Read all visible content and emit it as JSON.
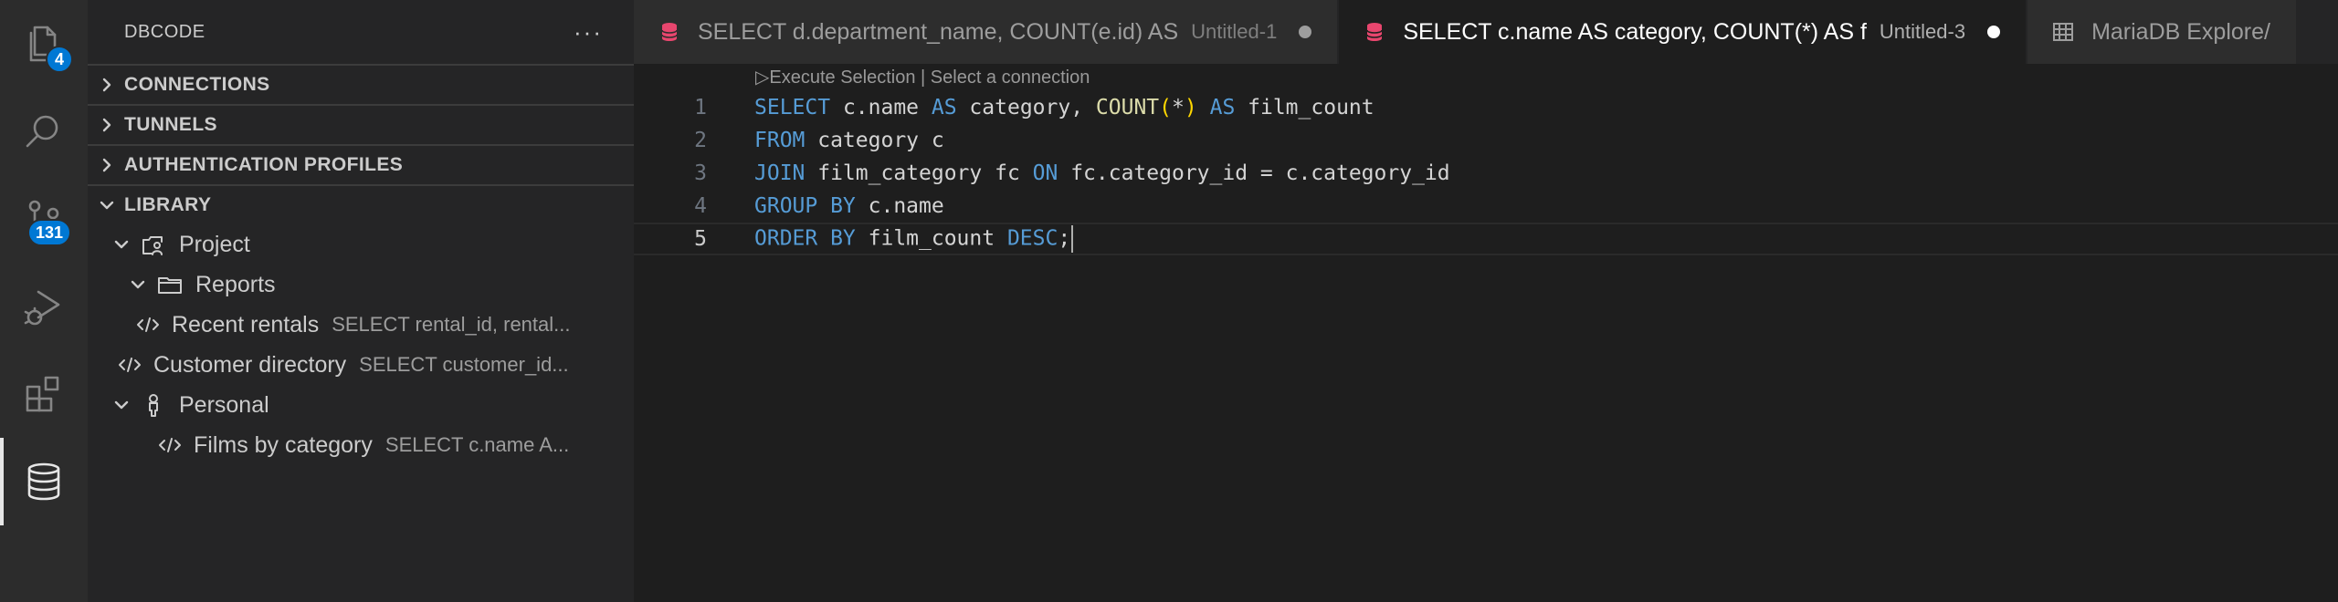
{
  "activity_bar": {
    "explorer_badge": "4",
    "scm_badge": "131",
    "icons": [
      "files-icon",
      "search-icon",
      "source-control-icon",
      "run-debug-icon",
      "extensions-icon",
      "database-icon"
    ]
  },
  "sidebar": {
    "title": "DBCODE",
    "more": "···",
    "sections": {
      "connections": "CONNECTIONS",
      "tunnels": "TUNNELS",
      "auth": "AUTHENTICATION PROFILES",
      "library": "LIBRARY"
    },
    "tree": {
      "project": "Project",
      "reports": "Reports",
      "recent_rentals": {
        "label": "Recent rentals",
        "desc": "SELECT rental_id, rental..."
      },
      "customer_directory": {
        "label": "Customer directory",
        "desc": "SELECT customer_id..."
      },
      "personal": "Personal",
      "films_by_category": {
        "label": "Films by category",
        "desc": "SELECT c.name A..."
      }
    }
  },
  "tabs": [
    {
      "title": "SELECT d.department_name, COUNT(e.id) AS",
      "desc": "Untitled-1"
    },
    {
      "title": "SELECT c.name AS category, COUNT(*) AS f",
      "desc": "Untitled-3"
    },
    {
      "title": "MariaDB Explore/"
    }
  ],
  "editor": {
    "codelens": "▷Execute Selection | Select a connection",
    "line_numbers": [
      "1",
      "2",
      "3",
      "4",
      "5"
    ],
    "lines": {
      "l1": {
        "k1": "SELECT",
        "t1": " c.name ",
        "k2": "AS",
        "t2": " category, ",
        "f1": "COUNT",
        "p1": "(",
        "t3": "*",
        "p2": ")",
        "t4": " ",
        "k3": "AS",
        "t5": " film_count"
      },
      "l2": {
        "k1": "FROM",
        "t1": " category c"
      },
      "l3": {
        "k1": "JOIN",
        "t1": " film_category fc ",
        "k2": "ON",
        "t2": " fc.category_id = c.category_id"
      },
      "l4": {
        "k1": "GROUP BY",
        "t1": " c.name"
      },
      "l5": {
        "k1": "ORDER BY",
        "t1": " film_count ",
        "k2": "DESC",
        "t2": ";"
      }
    }
  },
  "colors": {
    "keyword": "#569cd6",
    "function": "#dcdcaa",
    "bracket": "#ffd700",
    "badge": "#0078d4",
    "tab_db_icon": "#e8466e"
  }
}
